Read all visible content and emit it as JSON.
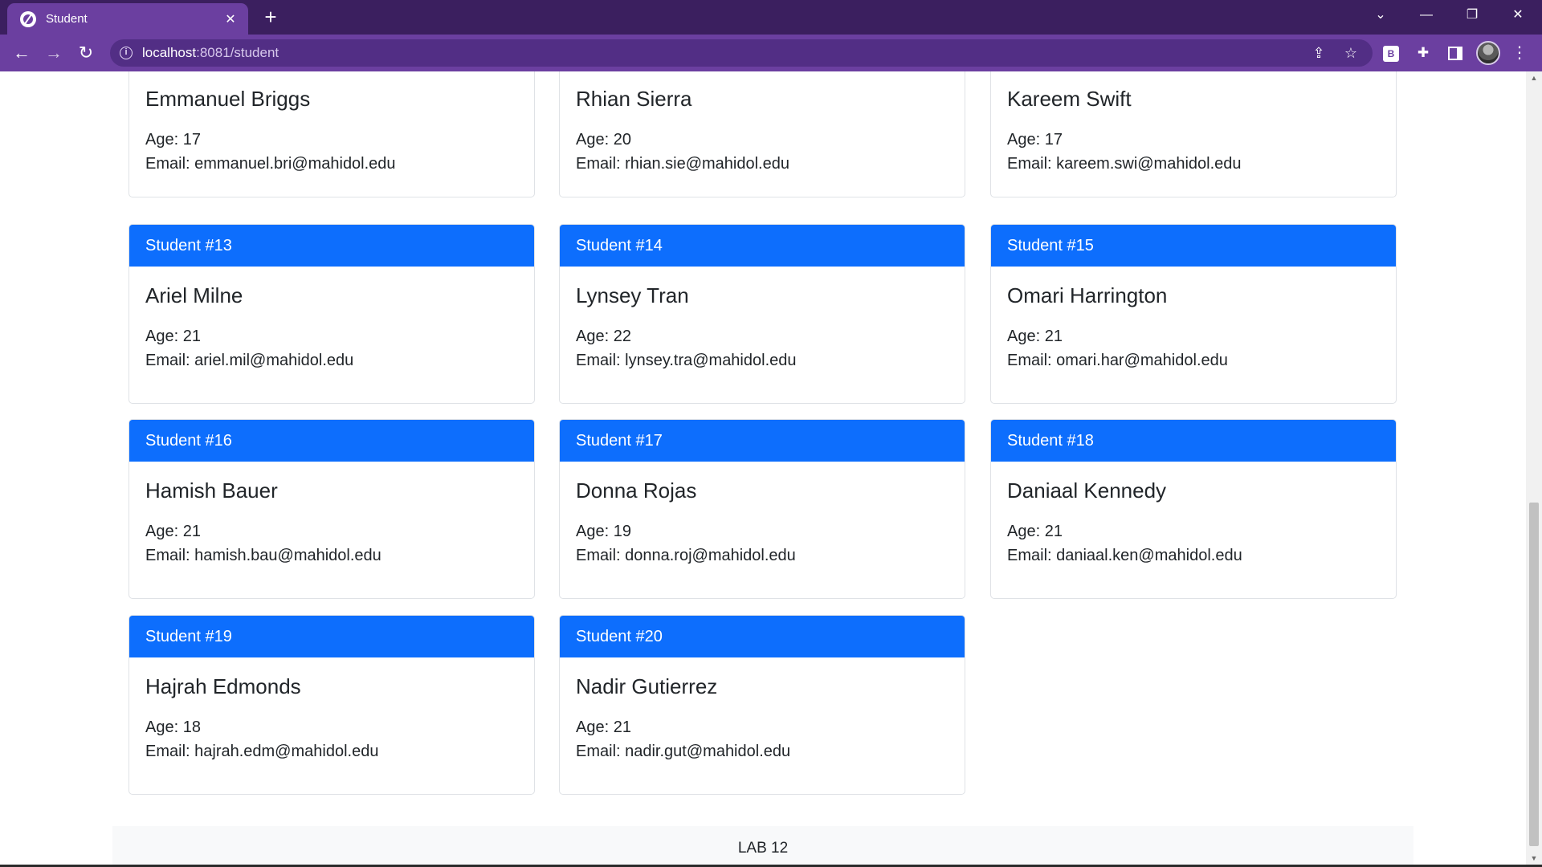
{
  "browser": {
    "tab_title": "Student",
    "close_glyph": "✕",
    "newtab_glyph": "+",
    "url_host": "localhost",
    "url_path": ":8081/student",
    "extension_badge": "B",
    "icons": {
      "back": "←",
      "forward": "→",
      "reload": "↻",
      "info": "i",
      "share": "⇪",
      "star": "☆",
      "puzzle": "✚",
      "menu": "⋮",
      "chevron": "⌄",
      "minimize": "—",
      "restore": "❐",
      "close": "✕"
    }
  },
  "students": [
    {
      "header": "",
      "name": "Emmanuel Briggs",
      "age": "Age: 17",
      "email": "Email: emmanuel.bri@mahidol.edu"
    },
    {
      "header": "",
      "name": "Rhian Sierra",
      "age": "Age: 20",
      "email": "Email: rhian.sie@mahidol.edu"
    },
    {
      "header": "",
      "name": "Kareem Swift",
      "age": "Age: 17",
      "email": "Email: kareem.swi@mahidol.edu"
    },
    {
      "header": "Student #13",
      "name": "Ariel Milne",
      "age": "Age: 21",
      "email": "Email: ariel.mil@mahidol.edu"
    },
    {
      "header": "Student #14",
      "name": "Lynsey Tran",
      "age": "Age: 22",
      "email": "Email: lynsey.tra@mahidol.edu"
    },
    {
      "header": "Student #15",
      "name": "Omari Harrington",
      "age": "Age: 21",
      "email": "Email: omari.har@mahidol.edu"
    },
    {
      "header": "Student #16",
      "name": "Hamish Bauer",
      "age": "Age: 21",
      "email": "Email: hamish.bau@mahidol.edu"
    },
    {
      "header": "Student #17",
      "name": "Donna Rojas",
      "age": "Age: 19",
      "email": "Email: donna.roj@mahidol.edu"
    },
    {
      "header": "Student #18",
      "name": "Daniaal Kennedy",
      "age": "Age: 21",
      "email": "Email: daniaal.ken@mahidol.edu"
    },
    {
      "header": "Student #19",
      "name": "Hajrah Edmonds",
      "age": "Age: 18",
      "email": "Email: hajrah.edm@mahidol.edu"
    },
    {
      "header": "Student #20",
      "name": "Nadir Gutierrez",
      "age": "Age: 21",
      "email": "Email: nadir.gut@mahidol.edu"
    }
  ],
  "footer": {
    "text": "LAB 12"
  },
  "colors": {
    "card_header": "#0d6efd",
    "browser_frame": "#6b3fa0",
    "tabstrip": "#3b1f5f"
  }
}
